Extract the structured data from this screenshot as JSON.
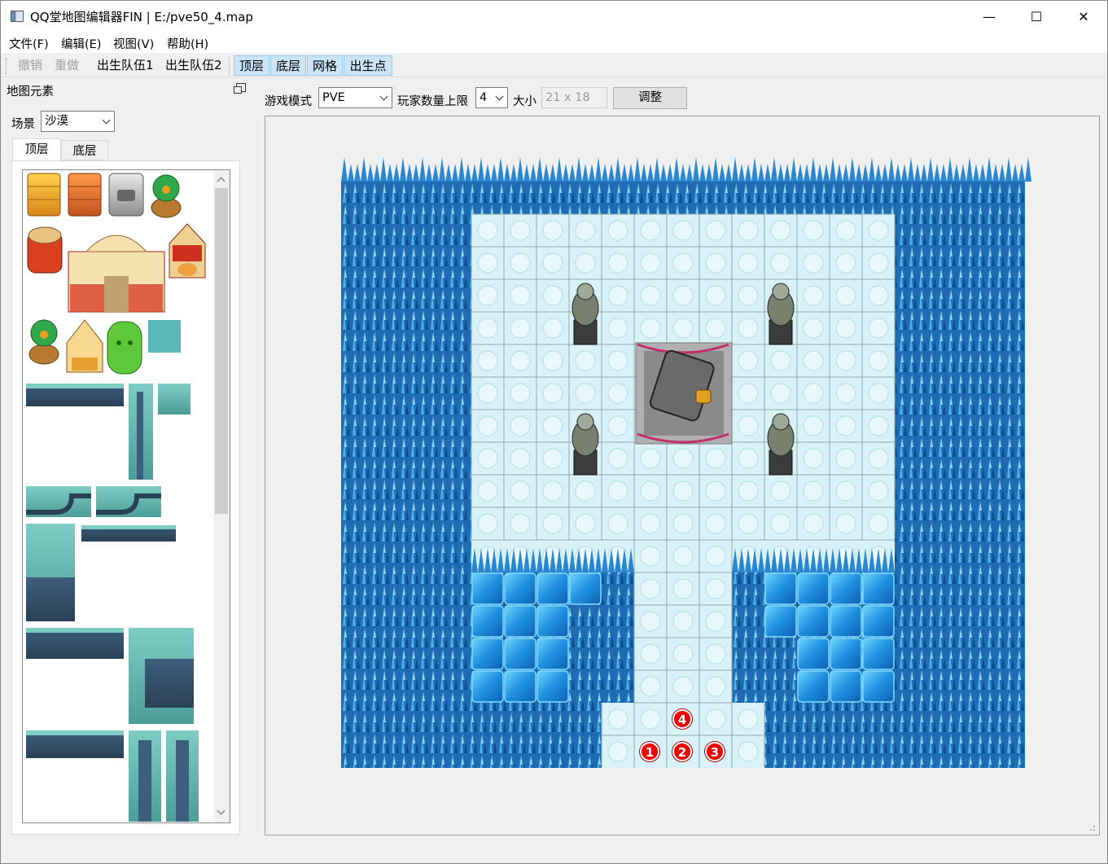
{
  "window": {
    "title": "QQ堂地图编辑器FIN | E:/pve50_4.map",
    "minimize": "—",
    "maximize": "☐",
    "close": "✕"
  },
  "menu": [
    "文件(F)",
    "编辑(E)",
    "视图(V)",
    "帮助(H)"
  ],
  "toolbar": {
    "undo": "撤销",
    "redo": "重做",
    "team1": "出生队伍1",
    "team2": "出生队伍2",
    "top_layer": "顶层",
    "bottom_layer": "底层",
    "grid": "网格",
    "spawn_points": "出生点"
  },
  "dock": {
    "title": "地图元素",
    "scene_label": "场景",
    "scene_value": "沙漠",
    "tabs": [
      "顶层",
      "底层"
    ]
  },
  "options": {
    "mode_label": "游戏模式",
    "mode_value": "PVE",
    "players_label": "玩家数量上限",
    "players_value": "4",
    "size_label": "大小",
    "size_value": "21 x 18",
    "adjust_button": "调整"
  },
  "map": {
    "cols": 21,
    "rows": 18,
    "spawns": [
      "1",
      "2",
      "3",
      "4"
    ]
  },
  "icons": {
    "app": "map-editor-icon",
    "float": "dock-float-icon"
  }
}
